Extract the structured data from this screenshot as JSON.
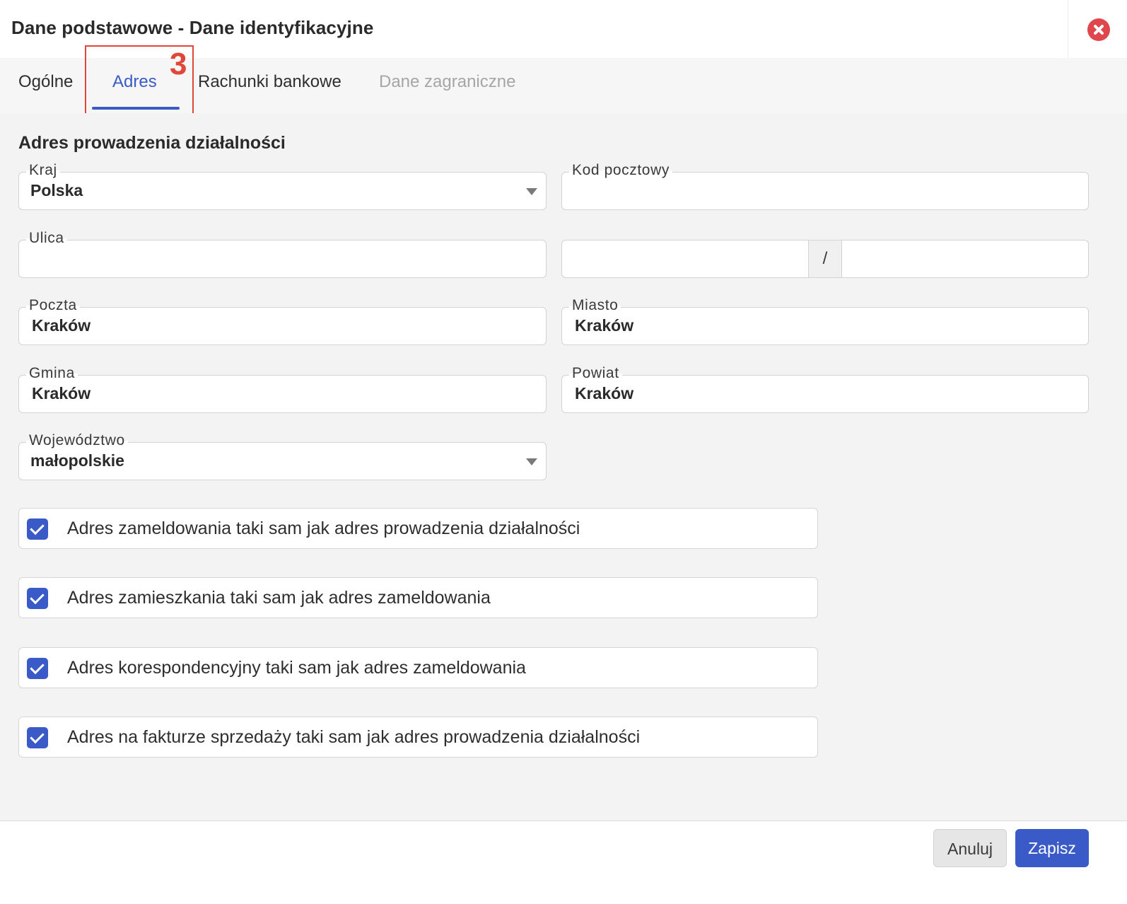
{
  "dialog": {
    "title": "Dane podstawowe - Dane identyfikacyjne"
  },
  "tabs": [
    {
      "label": "Ogólne",
      "state": "normal"
    },
    {
      "label": "Adres",
      "state": "active"
    },
    {
      "label": "Rachunki bankowe",
      "state": "normal"
    },
    {
      "label": "Dane zagraniczne",
      "state": "disabled"
    }
  ],
  "annotation": {
    "number": "3",
    "color": "#e0473a"
  },
  "section": {
    "title": "Adres prowadzenia działalności"
  },
  "fields": {
    "kraj": {
      "label": "Kraj",
      "value": "Polska"
    },
    "kod_pocztowy": {
      "label": "Kod pocztowy",
      "value": ""
    },
    "ulica": {
      "label": "Ulica",
      "value": ""
    },
    "numer": {
      "separator": "/"
    },
    "poczta": {
      "label": "Poczta",
      "value": "Kraków"
    },
    "miasto": {
      "label": "Miasto",
      "value": "Kraków"
    },
    "gmina": {
      "label": "Gmina",
      "value": "Kraków"
    },
    "powiat": {
      "label": "Powiat",
      "value": "Kraków"
    },
    "wojewodztwo": {
      "label": "Województwo",
      "value": "małopolskie"
    }
  },
  "checkboxes": [
    {
      "label": "Adres zameldowania taki sam jak adres prowadzenia działalności",
      "checked": true
    },
    {
      "label": "Adres zamieszkania taki sam jak adres zameldowania",
      "checked": true
    },
    {
      "label": "Adres korespondencyjny taki sam jak adres zameldowania",
      "checked": true
    },
    {
      "label": "Adres na fakturze sprzedaży taki sam jak adres prowadzenia działalności",
      "checked": true
    }
  ],
  "buttons": {
    "cancel": "Anuluj",
    "save": "Zapisz"
  },
  "colors": {
    "accent": "#3a5bc7",
    "close": "#e0474c"
  }
}
